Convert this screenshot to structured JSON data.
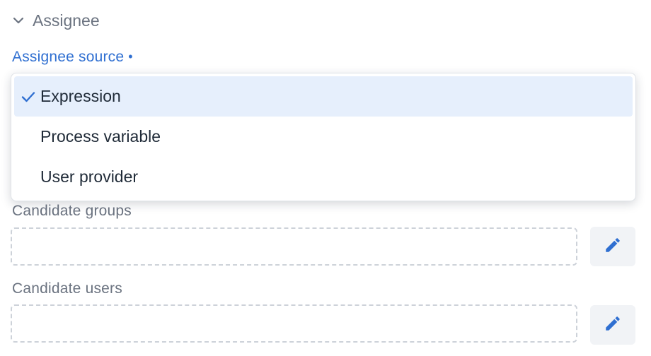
{
  "section": {
    "title": "Assignee",
    "icon": "chevron-down-icon"
  },
  "assignee_source": {
    "label": "Assignee source",
    "required_marker": "•",
    "accent_color": "#2f6fd1",
    "options": [
      {
        "label": "Expression",
        "selected": true
      },
      {
        "label": "Process variable",
        "selected": false
      },
      {
        "label": "User provider",
        "selected": false
      }
    ]
  },
  "candidate_groups": {
    "label": "Candidate groups",
    "value": "",
    "edit_icon": "pencil-icon"
  },
  "candidate_users": {
    "label": "Candidate users",
    "value": "",
    "edit_icon": "pencil-icon"
  }
}
